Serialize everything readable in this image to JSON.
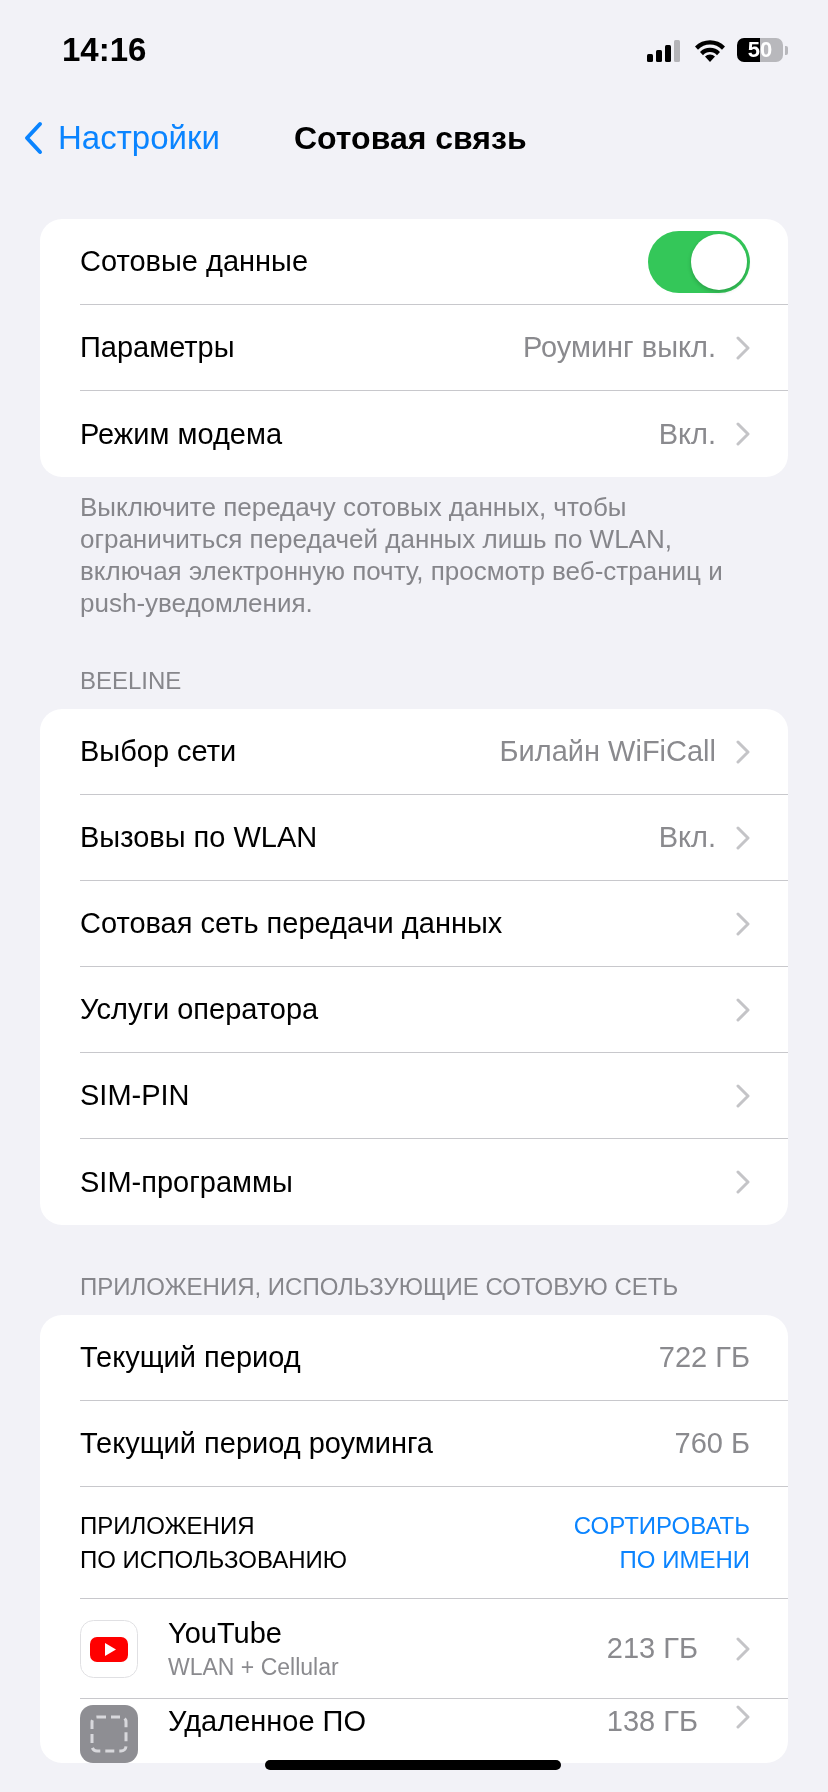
{
  "status_bar": {
    "time": "14:16",
    "battery": "50"
  },
  "nav": {
    "back": "Настройки",
    "title": "Сотовая связь"
  },
  "sections": [
    {
      "rows": [
        {
          "kind": "toggle",
          "label": "Сотовые данные",
          "on": true
        },
        {
          "kind": "detail",
          "label": "Параметры",
          "value": "Роуминг выкл."
        },
        {
          "kind": "detail",
          "label": "Режим модема",
          "value": "Вкл."
        }
      ],
      "footer": "Выключите передачу сотовых данных, чтобы ограничиться передачей данных лишь по WLAN, включая электронную почту, просмотр веб-страниц и push-уведомления."
    },
    {
      "header": "BEELINE",
      "rows": [
        {
          "kind": "detail",
          "label": "Выбор сети",
          "value": "Билайн WiFiCall"
        },
        {
          "kind": "detail",
          "label": "Вызовы по WLAN",
          "value": "Вкл."
        },
        {
          "kind": "detail",
          "label": "Сотовая сеть передачи данных"
        },
        {
          "kind": "detail",
          "label": "Услуги оператора"
        },
        {
          "kind": "detail",
          "label": "SIM-PIN"
        },
        {
          "kind": "detail",
          "label": "SIM-программы"
        }
      ]
    },
    {
      "header": "ПРИЛОЖЕНИЯ, ИСПОЛЬЗУЮЩИЕ СОТОВУЮ СЕТЬ",
      "rows": [
        {
          "kind": "stat",
          "label": "Текущий период",
          "value": "722 ГБ"
        },
        {
          "kind": "stat",
          "label": "Текущий период роуминга",
          "value": "760 Б"
        },
        {
          "kind": "sort",
          "label": "ПРИЛОЖЕНИЯ\nПО ИСПОЛЬЗОВАНИЮ",
          "action": "СОРТИРОВАТЬ\nПО ИМЕНИ"
        },
        {
          "kind": "app",
          "label": "YouTube",
          "subtitle": "WLAN + Cellular",
          "value": "213 ГБ"
        },
        {
          "kind": "app",
          "label": "Удаленное ПО",
          "value": "138 ГБ"
        }
      ]
    }
  ]
}
